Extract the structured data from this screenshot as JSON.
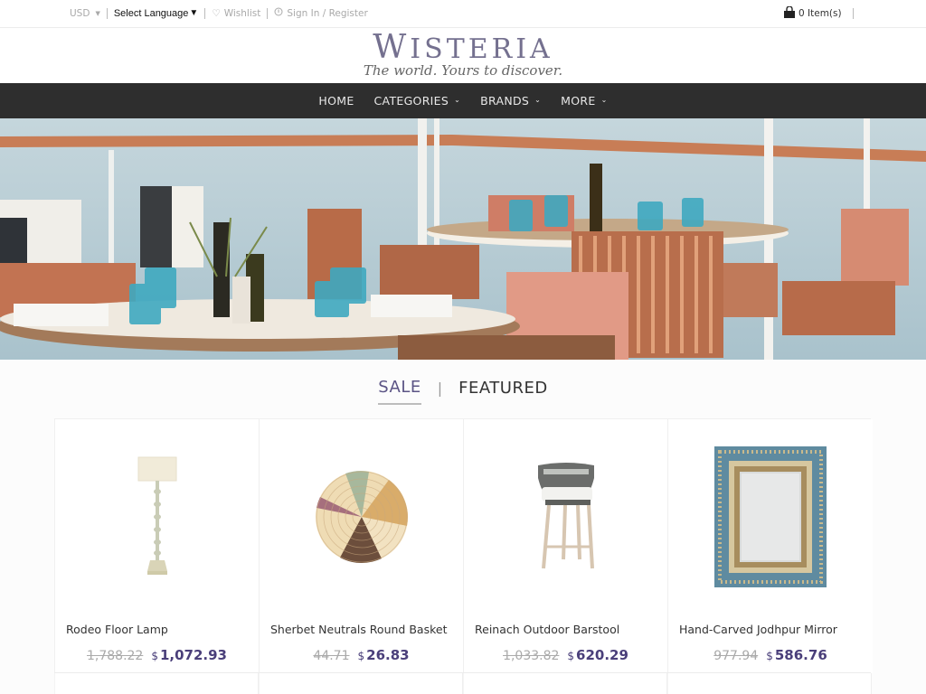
{
  "topbar": {
    "currency": "USD",
    "language": "Select Language",
    "wishlist": "Wishlist",
    "signin": "Sign In / Register",
    "cart": "0 Item(s)"
  },
  "logo": {
    "name_first": "W",
    "name_rest": "ISTERIA",
    "tagline": "The world. Yours to discover."
  },
  "nav": {
    "items": [
      {
        "label": "HOME",
        "has_dropdown": false
      },
      {
        "label": "CATEGORIES",
        "has_dropdown": true
      },
      {
        "label": "BRANDS",
        "has_dropdown": true
      },
      {
        "label": "MORE",
        "has_dropdown": true
      }
    ]
  },
  "hero": {
    "description": "Outdoor restaurant terrace with round tables, coral chairs and turquoise glasses overlooking the sea"
  },
  "tabs": {
    "items": [
      "SALE",
      "FEATURED"
    ],
    "active": "SALE",
    "separator": "|"
  },
  "products": [
    {
      "name": "Rodeo Floor Lamp",
      "old_price": "1,788.22",
      "currency": "$",
      "price": "1,072.93",
      "image": "floor-lamp"
    },
    {
      "name": "Sherbet Neutrals Round Basket",
      "old_price": "44.71",
      "currency": "$",
      "price": "26.83",
      "image": "round-basket"
    },
    {
      "name": "Reinach Outdoor Barstool",
      "old_price": "1,033.82",
      "currency": "$",
      "price": "620.29",
      "image": "barstool"
    },
    {
      "name": "Hand-Carved Jodhpur Mirror",
      "old_price": "977.94",
      "currency": "$",
      "price": "586.76",
      "image": "mirror"
    }
  ],
  "colors": {
    "brand": "#74708f",
    "nav_bg": "#2e2e2e",
    "price": "#4a3f7a",
    "active_tab": "#5b5485"
  }
}
